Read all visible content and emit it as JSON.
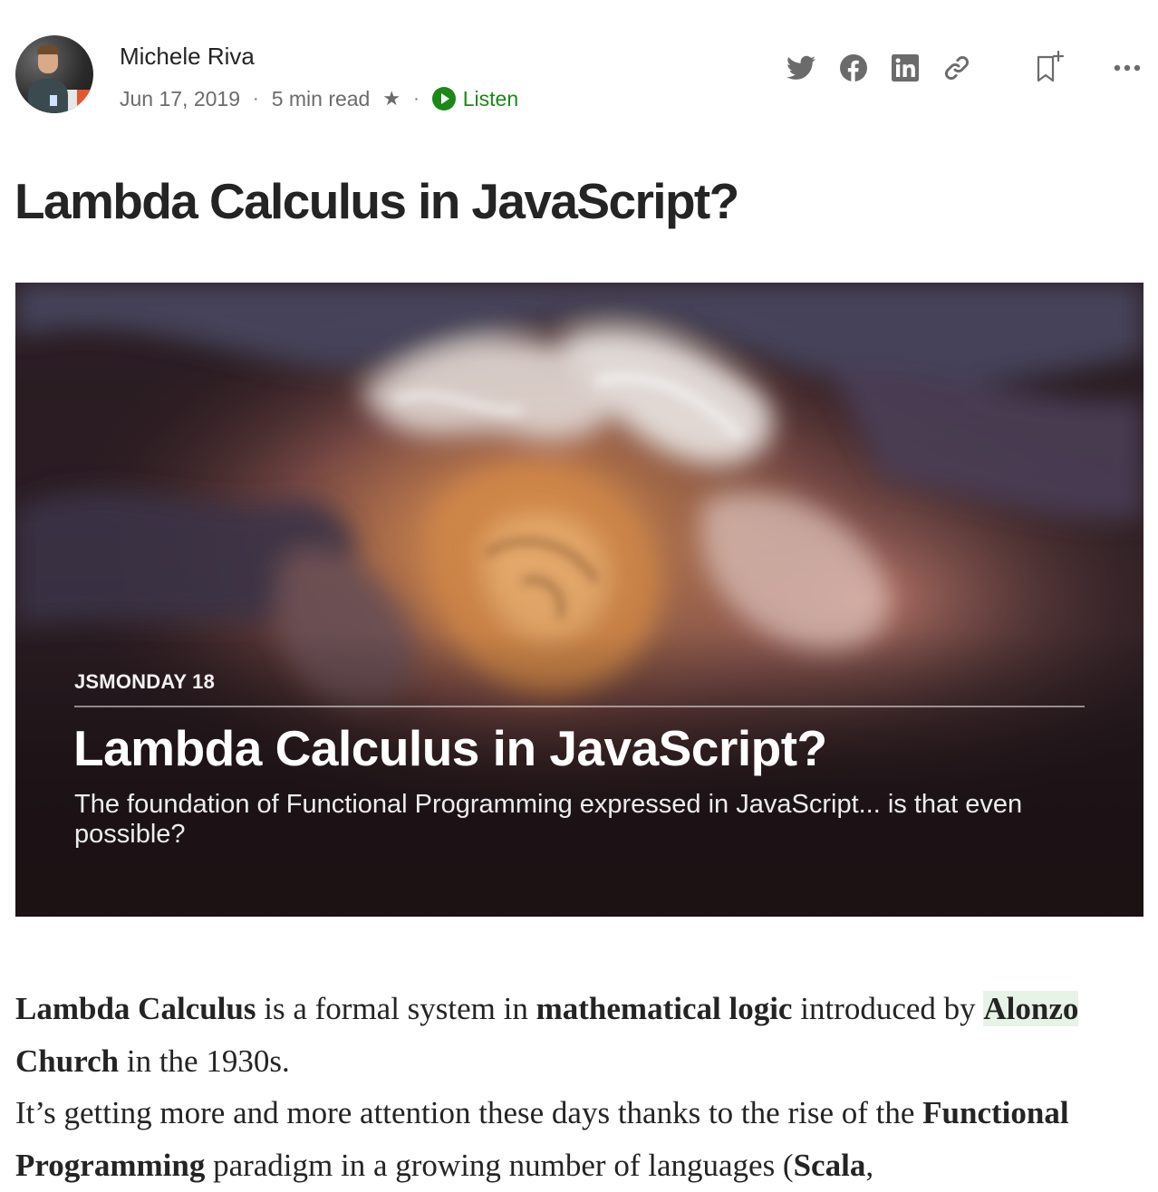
{
  "header": {
    "author_name": "Michele Riva",
    "date": "Jun 17, 2019",
    "separator": "·",
    "read_time": "5 min read",
    "star": "★",
    "listen_label": "Listen",
    "share_icons": [
      "twitter-icon",
      "facebook-icon",
      "linkedin-icon",
      "link-icon"
    ],
    "bookmark_icon": "bookmark-add-icon",
    "more_icon": "more-options-icon"
  },
  "article": {
    "title": "Lambda Calculus in JavaScript?",
    "hero": {
      "eyebrow": "JSMONDAY 18",
      "title": "Lambda Calculus in JavaScript?",
      "subtitle": "The foundation of Functional Programming expressed in JavaScript... is that even possible?"
    },
    "body": {
      "p1_part1": "Lambda Calculus",
      "p1_part2": " is a formal system in ",
      "p1_part3": "mathematical logic",
      "p1_part4": " introduced by ",
      "p1_part5": "Alonzo",
      "p1_part6": " ",
      "p1_part7": "Church",
      "p1_part8": " in the 1930s.",
      "p2_part1": "It’s getting more and more attention these days thanks to the rise of the ",
      "p2_part2": "Functional Programming",
      "p2_part3": " paradigm in a growing number of languages (",
      "p2_part4": "Scala",
      "p2_part5": ","
    }
  },
  "colors": {
    "text": "#242424",
    "muted": "#6b6b6b",
    "accent_green": "#1a8917",
    "highlight": "#e8f3e8"
  }
}
